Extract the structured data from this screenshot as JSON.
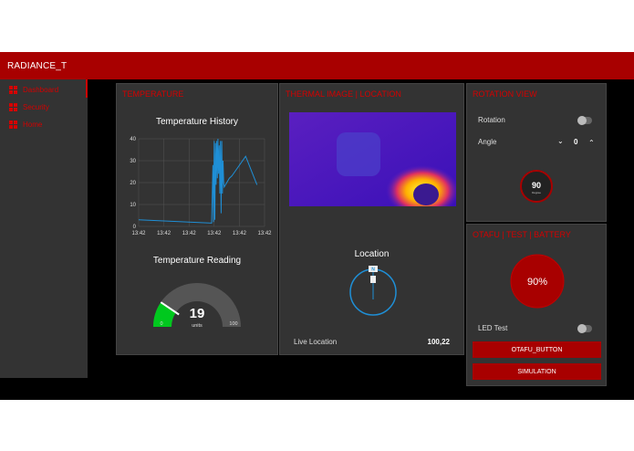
{
  "app": {
    "title": "RADIANCE_T"
  },
  "sidebar": {
    "items": [
      {
        "label": "Dashboard"
      },
      {
        "label": "Security"
      },
      {
        "label": "Home"
      }
    ]
  },
  "temperature_card": {
    "title": "TEMPERATURE",
    "history": {
      "title": "Temperature History",
      "chart_data": {
        "type": "line",
        "title": "Temperature History",
        "ylim": [
          0,
          40
        ],
        "yticks": [
          "0",
          "10",
          "20",
          "30",
          "40"
        ],
        "xticks": [
          "13:42",
          "13:42",
          "13:42",
          "13:42",
          "13:42",
          "13:42"
        ],
        "series": [
          {
            "values": [
              [
                0,
                3
              ],
              [
                0.58,
                1.5
              ],
              [
                0.59,
                28
              ],
              [
                0.595,
                2
              ],
              [
                0.6,
                39
              ],
              [
                0.605,
                3
              ],
              [
                0.61,
                38
              ],
              [
                0.615,
                19
              ],
              [
                0.62,
                39
              ],
              [
                0.625,
                22
              ],
              [
                0.63,
                40
              ],
              [
                0.635,
                24
              ],
              [
                0.64,
                37
              ],
              [
                0.645,
                15
              ],
              [
                0.65,
                39
              ],
              [
                0.655,
                6
              ],
              [
                0.66,
                39
              ],
              [
                0.665,
                15
              ],
              [
                0.67,
                30
              ],
              [
                0.675,
                20
              ],
              [
                0.68,
                18
              ],
              [
                0.72,
                22
              ],
              [
                0.74,
                23
              ],
              [
                0.85,
                32
              ],
              [
                0.94,
                19
              ]
            ]
          }
        ],
        "line_color": "#1f8fd6"
      }
    },
    "gauge": {
      "title": "Temperature Reading",
      "value": "19",
      "units": "units",
      "min": "0",
      "max": "100",
      "fraction": 0.19
    }
  },
  "thermal_card": {
    "title": "THERMAL IMAGE | LOCATION",
    "location_title": "Location",
    "compass_label": "N",
    "live_location_label": "Live Location",
    "live_location_value": "100,22"
  },
  "rotation_card": {
    "title": "ROTATION VIEW",
    "rotation_label": "Rotation",
    "angle_label": "Angle",
    "angle_value": "0",
    "dial_value": "90",
    "dial_units": "Degree"
  },
  "otafu_card": {
    "title": "OTAFU | TEST | BATTERY",
    "battery_value": "90%",
    "led_label": "LED Test",
    "otafu_button": "OTAFU_BUTTON",
    "simulation_button": "SIMULATION"
  },
  "colors": {
    "accent": "#a80000",
    "panel": "#333333",
    "line": "#1f8fd6",
    "gauge_fill": "#00c81e"
  }
}
